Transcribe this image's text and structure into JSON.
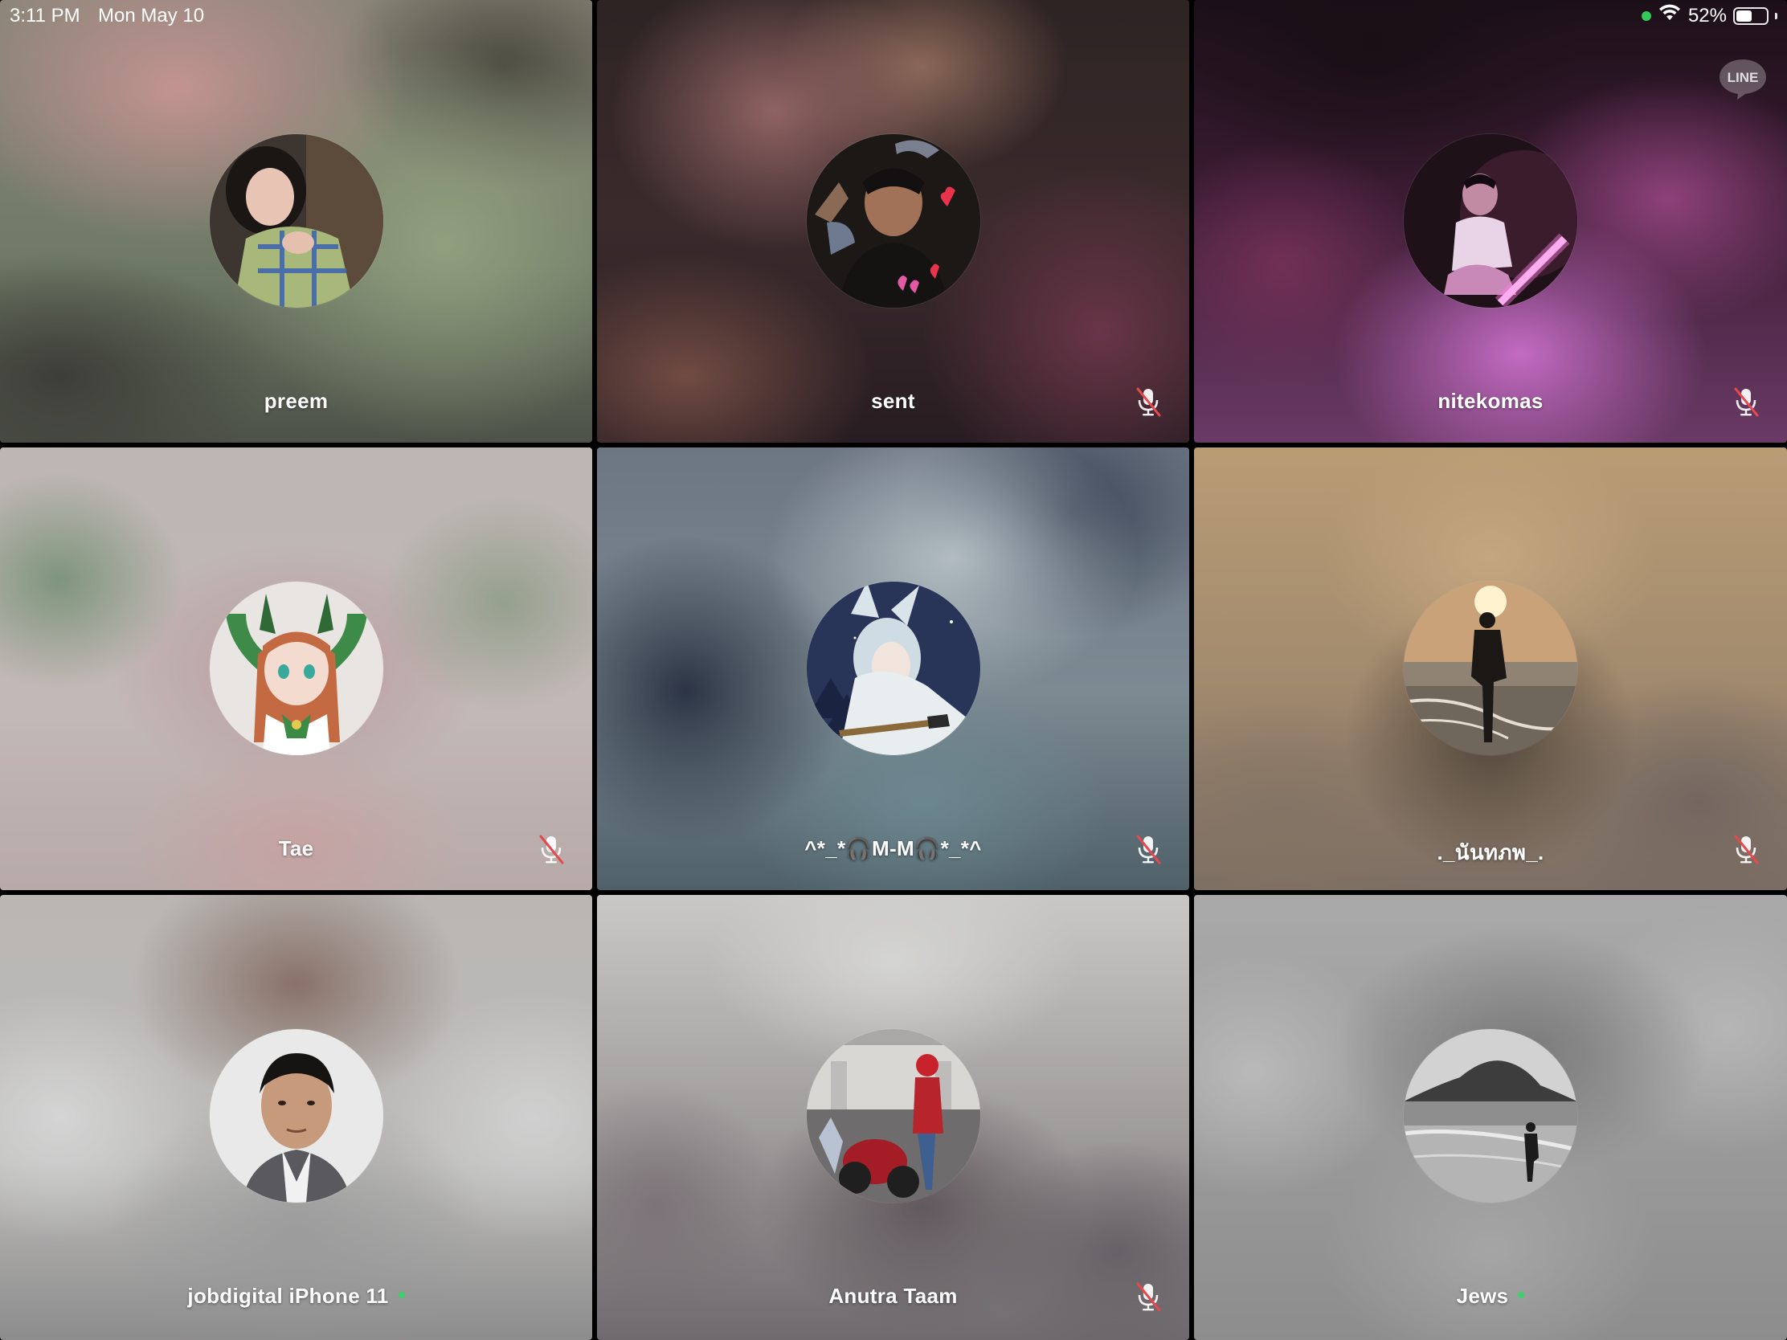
{
  "status_bar": {
    "time": "3:11 PM",
    "date": "Mon May 10",
    "battery_percent": "52%",
    "battery_level": 0.52,
    "icons": [
      "green-dot",
      "wifi-icon",
      "battery-icon"
    ]
  },
  "app_badge": "LINE",
  "participants": [
    {
      "name": "preem",
      "muted": false,
      "online": false
    },
    {
      "name": "sent",
      "muted": true,
      "online": false
    },
    {
      "name": "nitekomas",
      "muted": true,
      "online": false
    },
    {
      "name": "Tae",
      "muted": true,
      "online": false
    },
    {
      "name": "^*_*🎧M-M🎧*_*^",
      "muted": true,
      "online": false
    },
    {
      "name": "._นันทภพ_.",
      "muted": true,
      "online": false
    },
    {
      "name": "jobdigital iPhone 11",
      "muted": false,
      "online": true
    },
    {
      "name": "Anutra Taam",
      "muted": true,
      "online": false
    },
    {
      "name": "Jews",
      "muted": false,
      "online": true
    }
  ],
  "colors": {
    "online": "#3ed06b",
    "mute_slash": "#e5484d",
    "status_green": "#34c759"
  }
}
